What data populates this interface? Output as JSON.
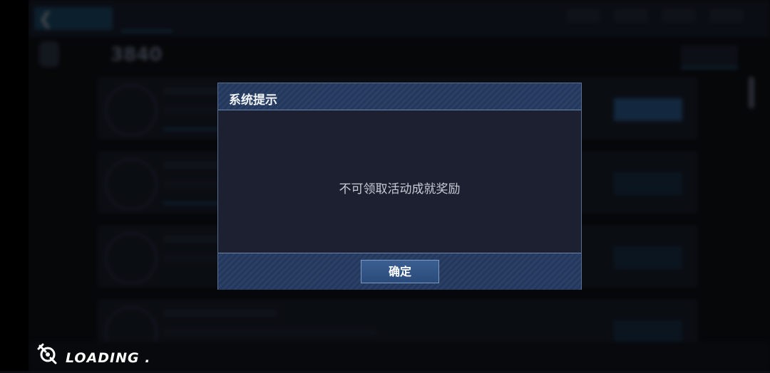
{
  "dialog": {
    "title": "系统提示",
    "message": "不可领取活动成就奖励",
    "confirm_label": "确定"
  },
  "loading": {
    "text": "LOADING ."
  },
  "background": {
    "header_score": "3840"
  },
  "colors": {
    "dialog_header": "#2a4068",
    "dialog_body": "#1d2030",
    "confirm_button": "#345686",
    "accent_blue": "#2b6aa0"
  }
}
